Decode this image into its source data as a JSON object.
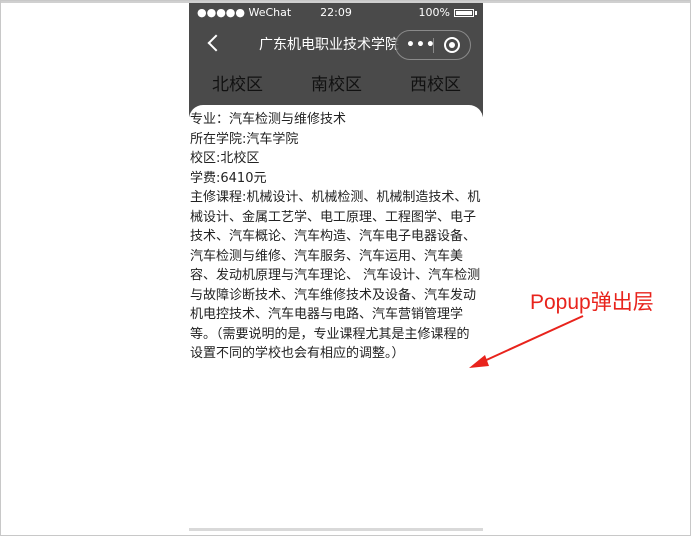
{
  "status_bar": {
    "carrier": "●●●●● WeChat",
    "time": "22:09",
    "battery": "100%"
  },
  "nav": {
    "title": "广东机电职业技术学院",
    "more_label": "•••"
  },
  "campus_tabs": [
    "北校区",
    "南校区",
    "西校区"
  ],
  "popup": {
    "major": "专业：汽车检测与维修技术",
    "college": "所在学院:汽车学院",
    "campus": "校区:北校区",
    "tuition": "学费:6410元",
    "courses": "主修课程:机械设计、机械检测、机械制造技术、机械设计、金属工艺学、电工原理、工程图学、电子技术、汽车概论、汽车构造、汽车电子电器设备、汽车检测与维修、汽车服务、汽车运用、汽车美容、发动机原理与汽车理论、 汽车设计、汽车检测与故障诊断技术、汽车维修技术及设备、汽车发动机电控技术、汽车电器与电路、汽车营销管理学等。（需要说明的是，专业课程尤其是主修课程的设置不同的学校也会有相应的调整。）"
  },
  "annotation": {
    "label": "Popup弹出层",
    "color": "#e8231c"
  }
}
